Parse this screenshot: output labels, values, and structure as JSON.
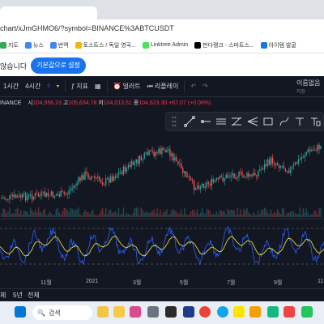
{
  "browser": {
    "url": "chart/xJmGHMO6/?symbol=BINANCE%3ABTCUSDT",
    "bookmarks": [
      {
        "label": "지도",
        "color": "#34a853"
      },
      {
        "label": "뉴스",
        "color": "#4285f4"
      },
      {
        "label": "번역",
        "color": "#4285f4"
      },
      {
        "label": "토스트스 / 독일 영국...",
        "color": "#f4b400"
      },
      {
        "label": "Linktree Admin",
        "color": "#43e55e"
      },
      {
        "label": "판다랭크 - 스마트스...",
        "color": "#000000"
      },
      {
        "label": "아이템 발굴",
        "color": "#1a73e8"
      }
    ]
  },
  "infobar": {
    "text": "않습니다",
    "button": "기본값으로 설정"
  },
  "toolbar": {
    "timeframe1": "1시간",
    "timeframe2": "4시간",
    "indicators": "지표",
    "alert": "얼러트",
    "replay": "리플레이",
    "layout_name": "이름없음",
    "layout_sub": "저장"
  },
  "legend": {
    "symbol": "INANCE",
    "open_label": "시",
    "open": "104,556.23",
    "high_label": "고",
    "high": "105,634.78",
    "low_label": "저",
    "low": "104,013.51",
    "close_label": "종",
    "close": "104,623.30",
    "change": "+67.07 (+0.06%)"
  },
  "axis": {
    "labels": [
      "11월",
      "2021",
      "3월",
      "5월",
      "7월",
      "9월",
      "11"
    ]
  },
  "bottombar": {
    "items": [
      "체",
      "5년",
      "전체"
    ]
  },
  "taskbar": {
    "search": "검색"
  },
  "colors": {
    "up": "#26a69a",
    "down": "#ef5350",
    "accent": "#2962ff",
    "rsi": "#2962ff",
    "rsi_ma": "#ffeb3b"
  }
}
